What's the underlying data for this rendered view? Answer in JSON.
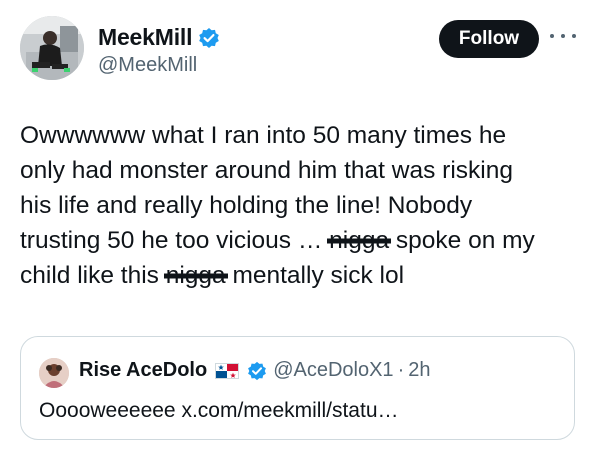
{
  "author": {
    "display_name": "MeekMill",
    "handle": "@MeekMill",
    "avatar_icon": "profile-photo",
    "verified_icon": "verified-badge-icon"
  },
  "actions": {
    "follow_label": "Follow",
    "more_icon": "ellipsis-icon"
  },
  "tweet": {
    "lines": [
      "Owwwwww what I ran into 50 many times he",
      "only had monster around him that was risking",
      "his life and really holding the line! Nobody"
    ],
    "line4_before": "trusting 50 he too vicious … ",
    "line4_censored": "nigga",
    "line4_after": " spoke on my",
    "line5_before": "child like this ",
    "line5_censored": "nigga",
    "line5_after": " mentally sick lol"
  },
  "quote": {
    "display_name": "Rise AceDolo",
    "flag_icon": "panama-flag-icon",
    "verified_icon": "verified-badge-icon",
    "handle": "@AceDoloX1",
    "separator": "·",
    "time": "2h",
    "text": "Ooooweeeeee x.com/meekmill/statu…"
  },
  "colors": {
    "verified_blue": "#1d9bf0",
    "text_primary": "#0f1419",
    "text_secondary": "#536471",
    "border": "#cfd9de"
  }
}
